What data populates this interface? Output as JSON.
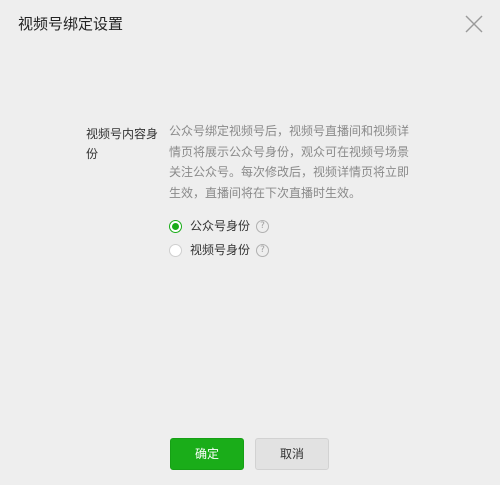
{
  "dialog": {
    "title": "视频号绑定设置"
  },
  "field": {
    "label": "视频号内容身份",
    "description": "公众号绑定视频号后，视频号直播间和视频详情页将展示公众号身份，观众可在视频号场景关注公众号。每次修改后，视频详情页将立即生效，直播间将在下次直播时生效。",
    "options": [
      {
        "label": "公众号身份",
        "selected": true
      },
      {
        "label": "视频号身份",
        "selected": false
      }
    ],
    "help_glyph": "?"
  },
  "footer": {
    "confirm_label": "确定",
    "cancel_label": "取消"
  },
  "colors": {
    "accent": "#1aad19",
    "background": "#eeeeee"
  },
  "icons": {
    "close": "close-icon",
    "help": "question-mark-icon"
  }
}
